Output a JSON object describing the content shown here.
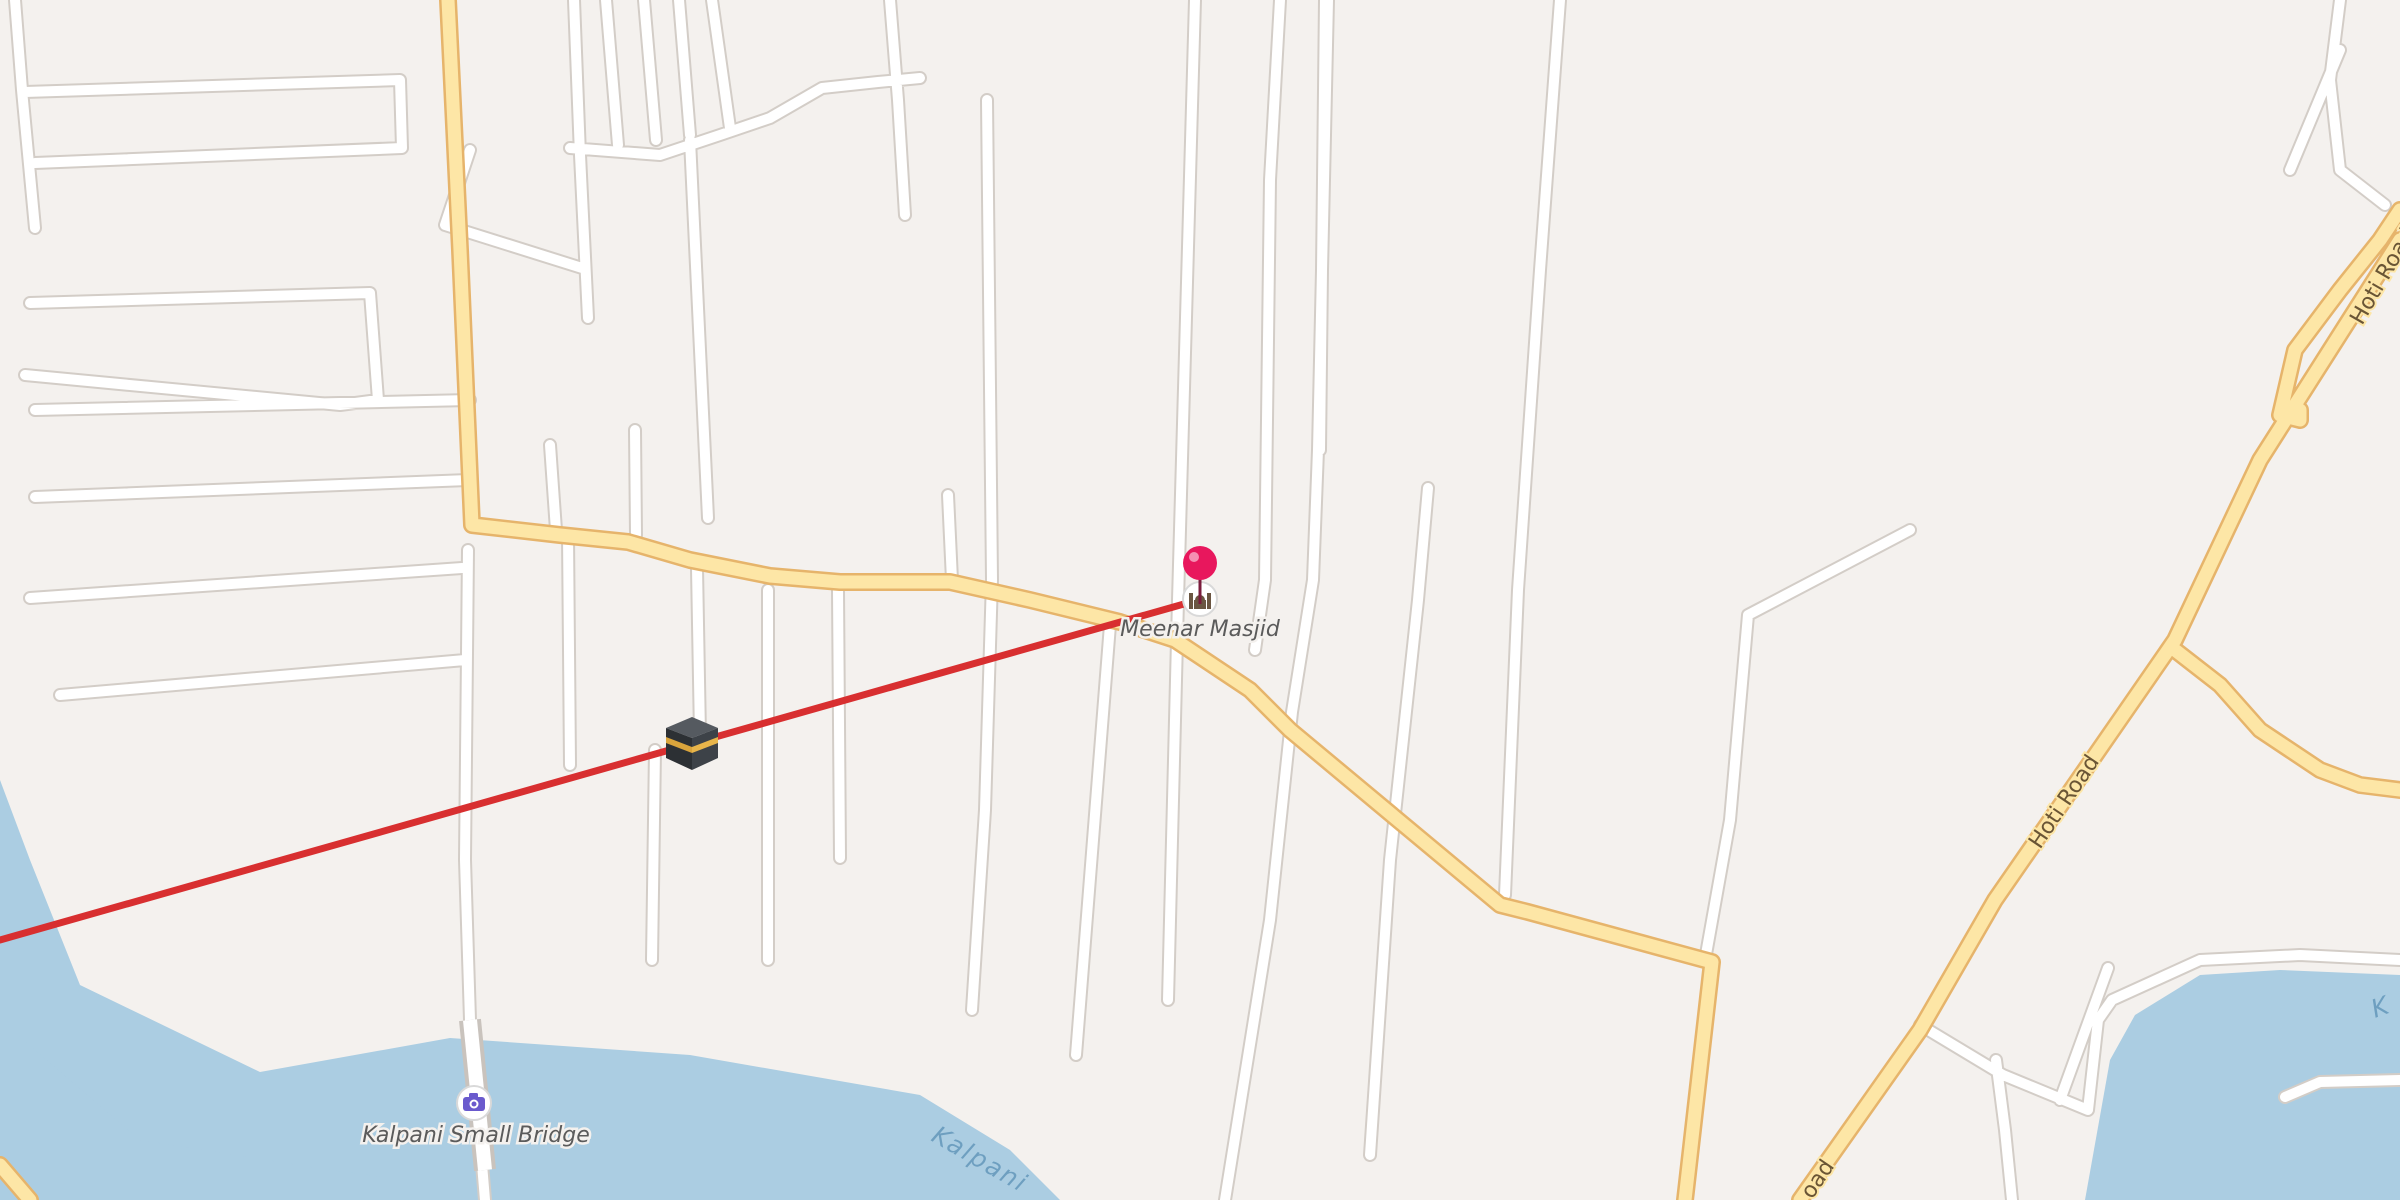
{
  "map": {
    "background_color": "#f4f1ee",
    "water_color": "#abcde2",
    "main_road_color": "#fde6a6",
    "minor_road_color": "#ffffff",
    "route_color": "#d82f30"
  },
  "places": {
    "mosque": {
      "name": "Meenar Masjid",
      "icon": "mosque-icon"
    },
    "bridge": {
      "name": "Kalpani Small Bridge",
      "icon": "camera-icon"
    },
    "kaaba": {
      "icon": "kaaba-icon"
    }
  },
  "marker": {
    "icon": "map-pin-icon",
    "color": "#e8175d"
  },
  "roads": {
    "hoti_road_north": "Hoti Road",
    "hoti_road_south": "Hoti Road",
    "road_partial_bottom": "oad"
  },
  "waterways": {
    "kalpani_river_label": "Kalpani",
    "kalpani_river_partial_right": "K"
  }
}
